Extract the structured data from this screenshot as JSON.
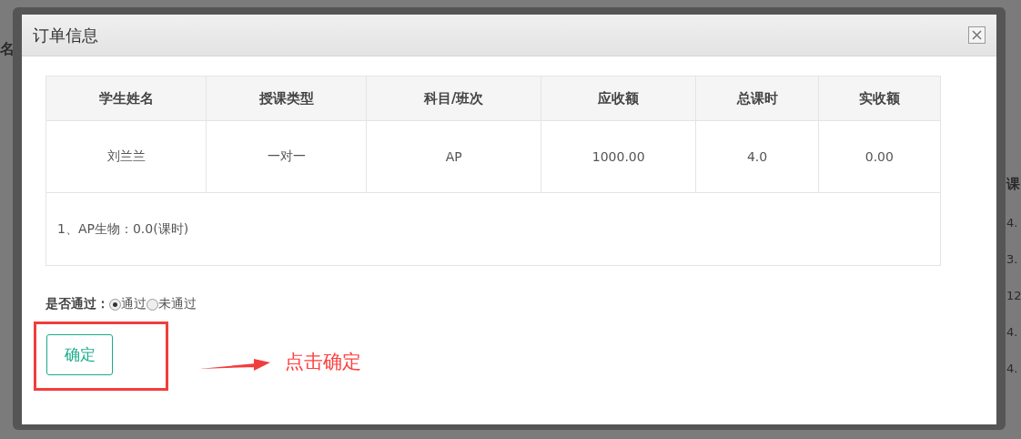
{
  "background": {
    "left_header": "名",
    "right_header": "课",
    "right_values": [
      "4.",
      "3.",
      "12",
      "4.",
      "4."
    ]
  },
  "dialog": {
    "title": "订单信息",
    "table": {
      "columns": [
        "学生姓名",
        "授课类型",
        "科目/班次",
        "应收额",
        "总课时",
        "实收额"
      ],
      "rows": [
        [
          "刘兰兰",
          "一对一",
          "AP",
          "1000.00",
          "4.0",
          "0.00"
        ]
      ],
      "note": "1、AP生物：0.0(课时)"
    },
    "pass_question": {
      "label": "是否通过：",
      "options": [
        {
          "label": "通过",
          "selected": true
        },
        {
          "label": "未通过",
          "selected": false
        }
      ]
    },
    "confirm_button": "确定",
    "annotation": "点击确定"
  }
}
